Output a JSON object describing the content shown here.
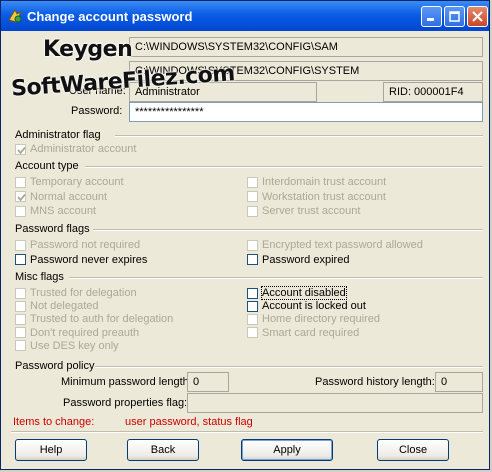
{
  "window": {
    "title": "Change account password",
    "controls": [
      "minimize-icon",
      "maximize-icon",
      "close-icon"
    ]
  },
  "watermark": {
    "line1": "Keygen",
    "line2": "SoftWareFilez.com"
  },
  "fields": {
    "path_sam": "C:\\WINDOWS\\SYSTEM32\\CONFIG\\SAM",
    "path_system": "C:\\WINDOWS\\SYSTEM32\\CONFIG\\SYSTEM",
    "username_label": "User name:",
    "username": "Administrator",
    "rid": "RID: 000001F4",
    "password_label": "Password:",
    "password": "****************"
  },
  "admin_flag": {
    "title": "Administrator flag",
    "items": [
      {
        "label": "Administrator account",
        "checked": true,
        "enabled": false
      }
    ]
  },
  "account_type": {
    "title": "Account type",
    "left": [
      {
        "label": "Temporary account",
        "checked": false,
        "enabled": false
      },
      {
        "label": "Normal account",
        "checked": true,
        "enabled": false
      },
      {
        "label": "MNS account",
        "checked": false,
        "enabled": false
      }
    ],
    "right": [
      {
        "label": "Interdomain trust account",
        "checked": false,
        "enabled": false
      },
      {
        "label": "Workstation trust account",
        "checked": false,
        "enabled": false
      },
      {
        "label": "Server trust account",
        "checked": false,
        "enabled": false
      }
    ]
  },
  "password_flags": {
    "title": "Password flags",
    "left": [
      {
        "label": "Password not required",
        "checked": false,
        "enabled": false
      },
      {
        "label": "Password never expires",
        "checked": false,
        "enabled": true
      }
    ],
    "right": [
      {
        "label": "Encrypted text password allowed",
        "checked": false,
        "enabled": false
      },
      {
        "label": "Password expired",
        "checked": false,
        "enabled": true
      }
    ]
  },
  "misc_flags": {
    "title": "Misc flags",
    "left": [
      {
        "label": "Trusted for delegation",
        "checked": false,
        "enabled": false
      },
      {
        "label": "Not delegated",
        "checked": false,
        "enabled": false
      },
      {
        "label": "Trusted to auth for delegation",
        "checked": false,
        "enabled": false
      },
      {
        "label": "Don't required preauth",
        "checked": false,
        "enabled": false
      },
      {
        "label": "Use DES key only",
        "checked": false,
        "enabled": false
      }
    ],
    "right": [
      {
        "label": "Account disabled",
        "checked": false,
        "enabled": true,
        "focused": true
      },
      {
        "label": "Account is locked out",
        "checked": false,
        "enabled": true
      },
      {
        "label": "Home directory required",
        "checked": false,
        "enabled": false
      },
      {
        "label": "Smart card required",
        "checked": false,
        "enabled": false
      }
    ]
  },
  "policy": {
    "title": "Password policy",
    "min_len_label": "Minimum password length:",
    "min_len": "0",
    "history_label": "Password history length:",
    "history": "0",
    "props_label": "Password properties flag:",
    "props": ""
  },
  "changes": {
    "label": "Items to change:",
    "value": "user password, status flag"
  },
  "buttons": {
    "help": "Help",
    "back": "Back",
    "apply": "Apply",
    "close": "Close"
  },
  "colors": {
    "title_bar": "#0b5ce6",
    "changes_text": "#cc0000"
  }
}
